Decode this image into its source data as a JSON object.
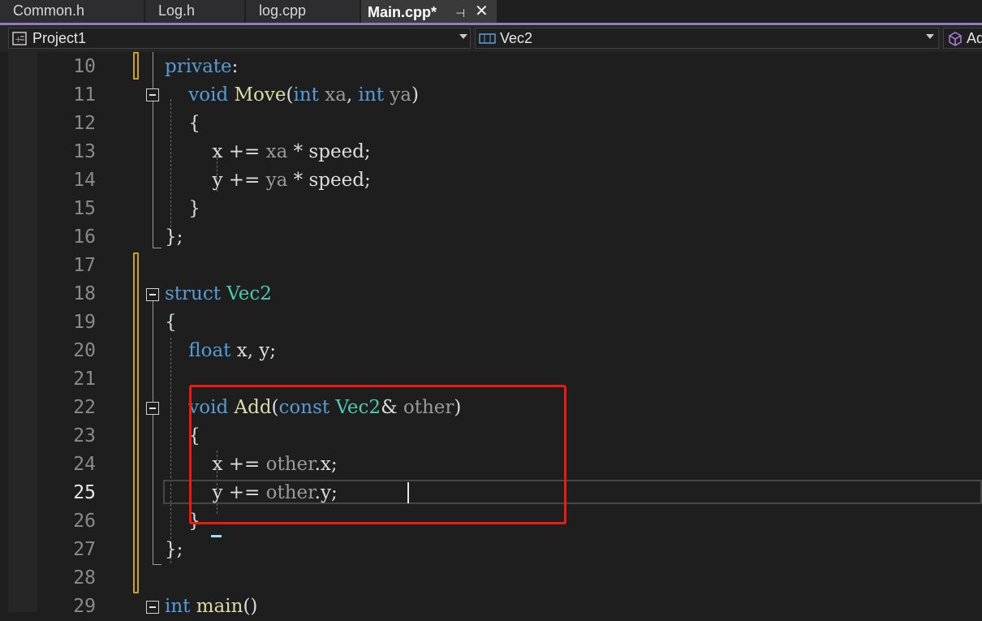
{
  "tabs": [
    {
      "label": "Common.h",
      "active": false
    },
    {
      "label": "Log.h",
      "active": false
    },
    {
      "label": "log.cpp",
      "active": false
    },
    {
      "label": "Main.cpp*",
      "active": true
    }
  ],
  "tab_icons": {
    "pin": "pin-icon",
    "close": "close-icon"
  },
  "navbar": {
    "project": "Project1",
    "scope": "Vec2",
    "member": "Ad"
  },
  "colors": {
    "keyword": "#569cd6",
    "type": "#4ec9b0",
    "function": "#dcdcaa",
    "param": "#9a9a9a",
    "highlight_box": "#f0190f",
    "change_marker": "#c9a227",
    "accent": "#8e7cc3"
  },
  "editor": {
    "current_line": "25",
    "lines": [
      {
        "num": "10",
        "tokens": [
          {
            "t": "private",
            "c": "kw"
          },
          {
            "t": ":",
            "c": "tx"
          }
        ]
      },
      {
        "num": "11",
        "tokens": [
          {
            "t": "    ",
            "c": "tx"
          },
          {
            "t": "void",
            "c": "kw"
          },
          {
            "t": " ",
            "c": "tx"
          },
          {
            "t": "Move",
            "c": "fn"
          },
          {
            "t": "(",
            "c": "tx"
          },
          {
            "t": "int",
            "c": "kw"
          },
          {
            "t": " ",
            "c": "tx"
          },
          {
            "t": "xa",
            "c": "pm"
          },
          {
            "t": ", ",
            "c": "tx"
          },
          {
            "t": "int",
            "c": "kw"
          },
          {
            "t": " ",
            "c": "tx"
          },
          {
            "t": "ya",
            "c": "pm"
          },
          {
            "t": ")",
            "c": "tx"
          }
        ]
      },
      {
        "num": "12",
        "tokens": [
          {
            "t": "    {",
            "c": "tx"
          }
        ]
      },
      {
        "num": "13",
        "tokens": [
          {
            "t": "        x += ",
            "c": "tx"
          },
          {
            "t": "xa",
            "c": "pm"
          },
          {
            "t": " * speed;",
            "c": "tx"
          }
        ]
      },
      {
        "num": "14",
        "tokens": [
          {
            "t": "        y += ",
            "c": "tx"
          },
          {
            "t": "ya",
            "c": "pm"
          },
          {
            "t": " * speed;",
            "c": "tx"
          }
        ]
      },
      {
        "num": "15",
        "tokens": [
          {
            "t": "    }",
            "c": "tx"
          }
        ]
      },
      {
        "num": "16",
        "tokens": [
          {
            "t": "};",
            "c": "tx"
          }
        ]
      },
      {
        "num": "17",
        "tokens": []
      },
      {
        "num": "18",
        "tokens": [
          {
            "t": "struct",
            "c": "kw"
          },
          {
            "t": " ",
            "c": "tx"
          },
          {
            "t": "Vec2",
            "c": "ty"
          }
        ]
      },
      {
        "num": "19",
        "tokens": [
          {
            "t": "{",
            "c": "tx"
          }
        ]
      },
      {
        "num": "20",
        "tokens": [
          {
            "t": "    ",
            "c": "tx"
          },
          {
            "t": "float",
            "c": "kw"
          },
          {
            "t": " x, y;",
            "c": "tx"
          }
        ]
      },
      {
        "num": "21",
        "tokens": []
      },
      {
        "num": "22",
        "tokens": [
          {
            "t": "    ",
            "c": "tx"
          },
          {
            "t": "void",
            "c": "kw"
          },
          {
            "t": " ",
            "c": "tx"
          },
          {
            "t": "Add",
            "c": "fn"
          },
          {
            "t": "(",
            "c": "tx"
          },
          {
            "t": "const",
            "c": "kw"
          },
          {
            "t": " ",
            "c": "tx"
          },
          {
            "t": "Vec2",
            "c": "ty"
          },
          {
            "t": "& ",
            "c": "tx"
          },
          {
            "t": "other",
            "c": "pm"
          },
          {
            "t": ")",
            "c": "tx"
          }
        ]
      },
      {
        "num": "23",
        "tokens": [
          {
            "t": "    {",
            "c": "tx"
          }
        ]
      },
      {
        "num": "24",
        "tokens": [
          {
            "t": "        x += ",
            "c": "tx"
          },
          {
            "t": "other",
            "c": "pm"
          },
          {
            "t": ".x;",
            "c": "tx"
          }
        ]
      },
      {
        "num": "25",
        "tokens": [
          {
            "t": "        y += ",
            "c": "tx"
          },
          {
            "t": "other",
            "c": "pm"
          },
          {
            "t": ".y;",
            "c": "tx"
          }
        ]
      },
      {
        "num": "26",
        "tokens": [
          {
            "t": "    }",
            "c": "tx"
          }
        ]
      },
      {
        "num": "27",
        "tokens": [
          {
            "t": "};",
            "c": "tx"
          }
        ]
      },
      {
        "num": "28",
        "tokens": []
      },
      {
        "num": "29",
        "tokens": [
          {
            "t": "int",
            "c": "kw"
          },
          {
            "t": " ",
            "c": "tx"
          },
          {
            "t": "main",
            "c": "fn"
          },
          {
            "t": "()",
            "c": "tx"
          }
        ]
      }
    ]
  }
}
